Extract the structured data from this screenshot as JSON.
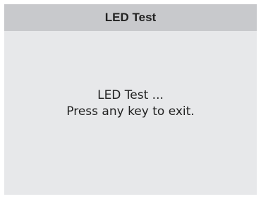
{
  "window": {
    "title": "LED Test"
  },
  "main": {
    "message_line1": "LED Test ...",
    "message_line2": "Press any key to exit."
  },
  "colors": {
    "title_bar": "#c8c9cc",
    "background": "#e7e8ea",
    "text": "#222222"
  }
}
